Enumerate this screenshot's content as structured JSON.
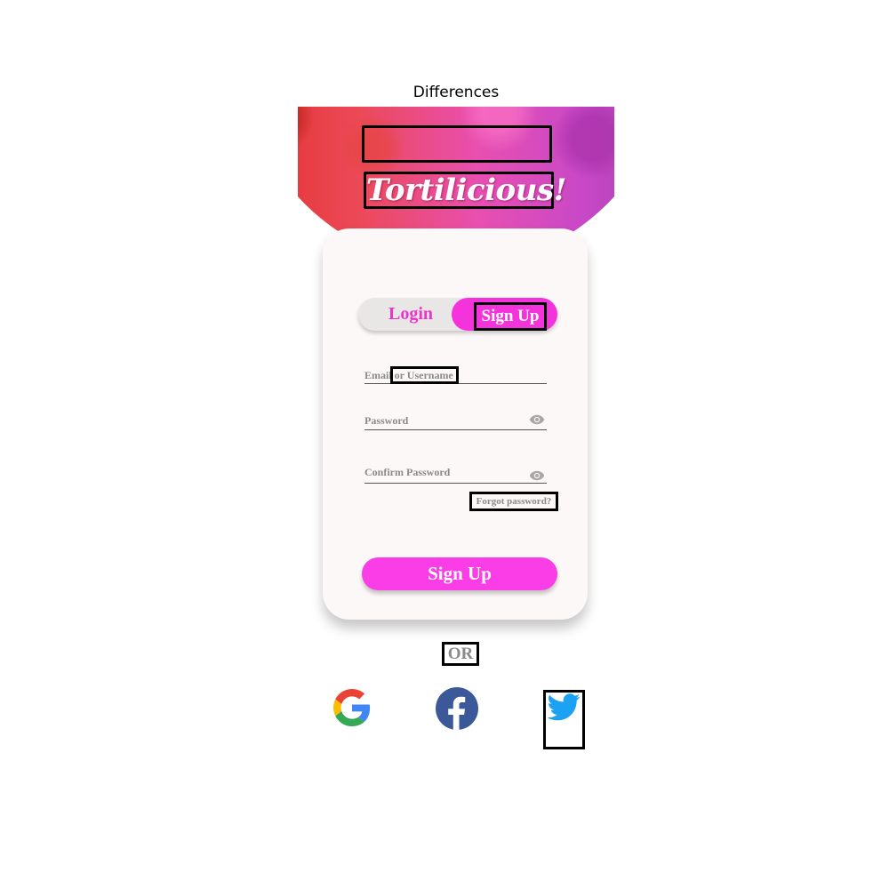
{
  "figure_title": "Differences",
  "app": {
    "title": "Tortilicious!"
  },
  "auth": {
    "tabs": {
      "login": "Login",
      "signup": "Sign Up"
    },
    "fields": {
      "email_placeholder": "Email or Username",
      "password_placeholder": "Password",
      "confirm_placeholder": "Confirm Password"
    },
    "forgot_label": "Forgot password?",
    "submit_label": "Sign Up",
    "divider_label": "OR"
  },
  "social": [
    "google-icon",
    "facebook-icon",
    "twitter-icon"
  ],
  "colors": {
    "accent": "#f433dc",
    "card": "#fcf8f7",
    "toggle_track": "#e9e7e6",
    "muted_text": "#8a8a8a"
  }
}
